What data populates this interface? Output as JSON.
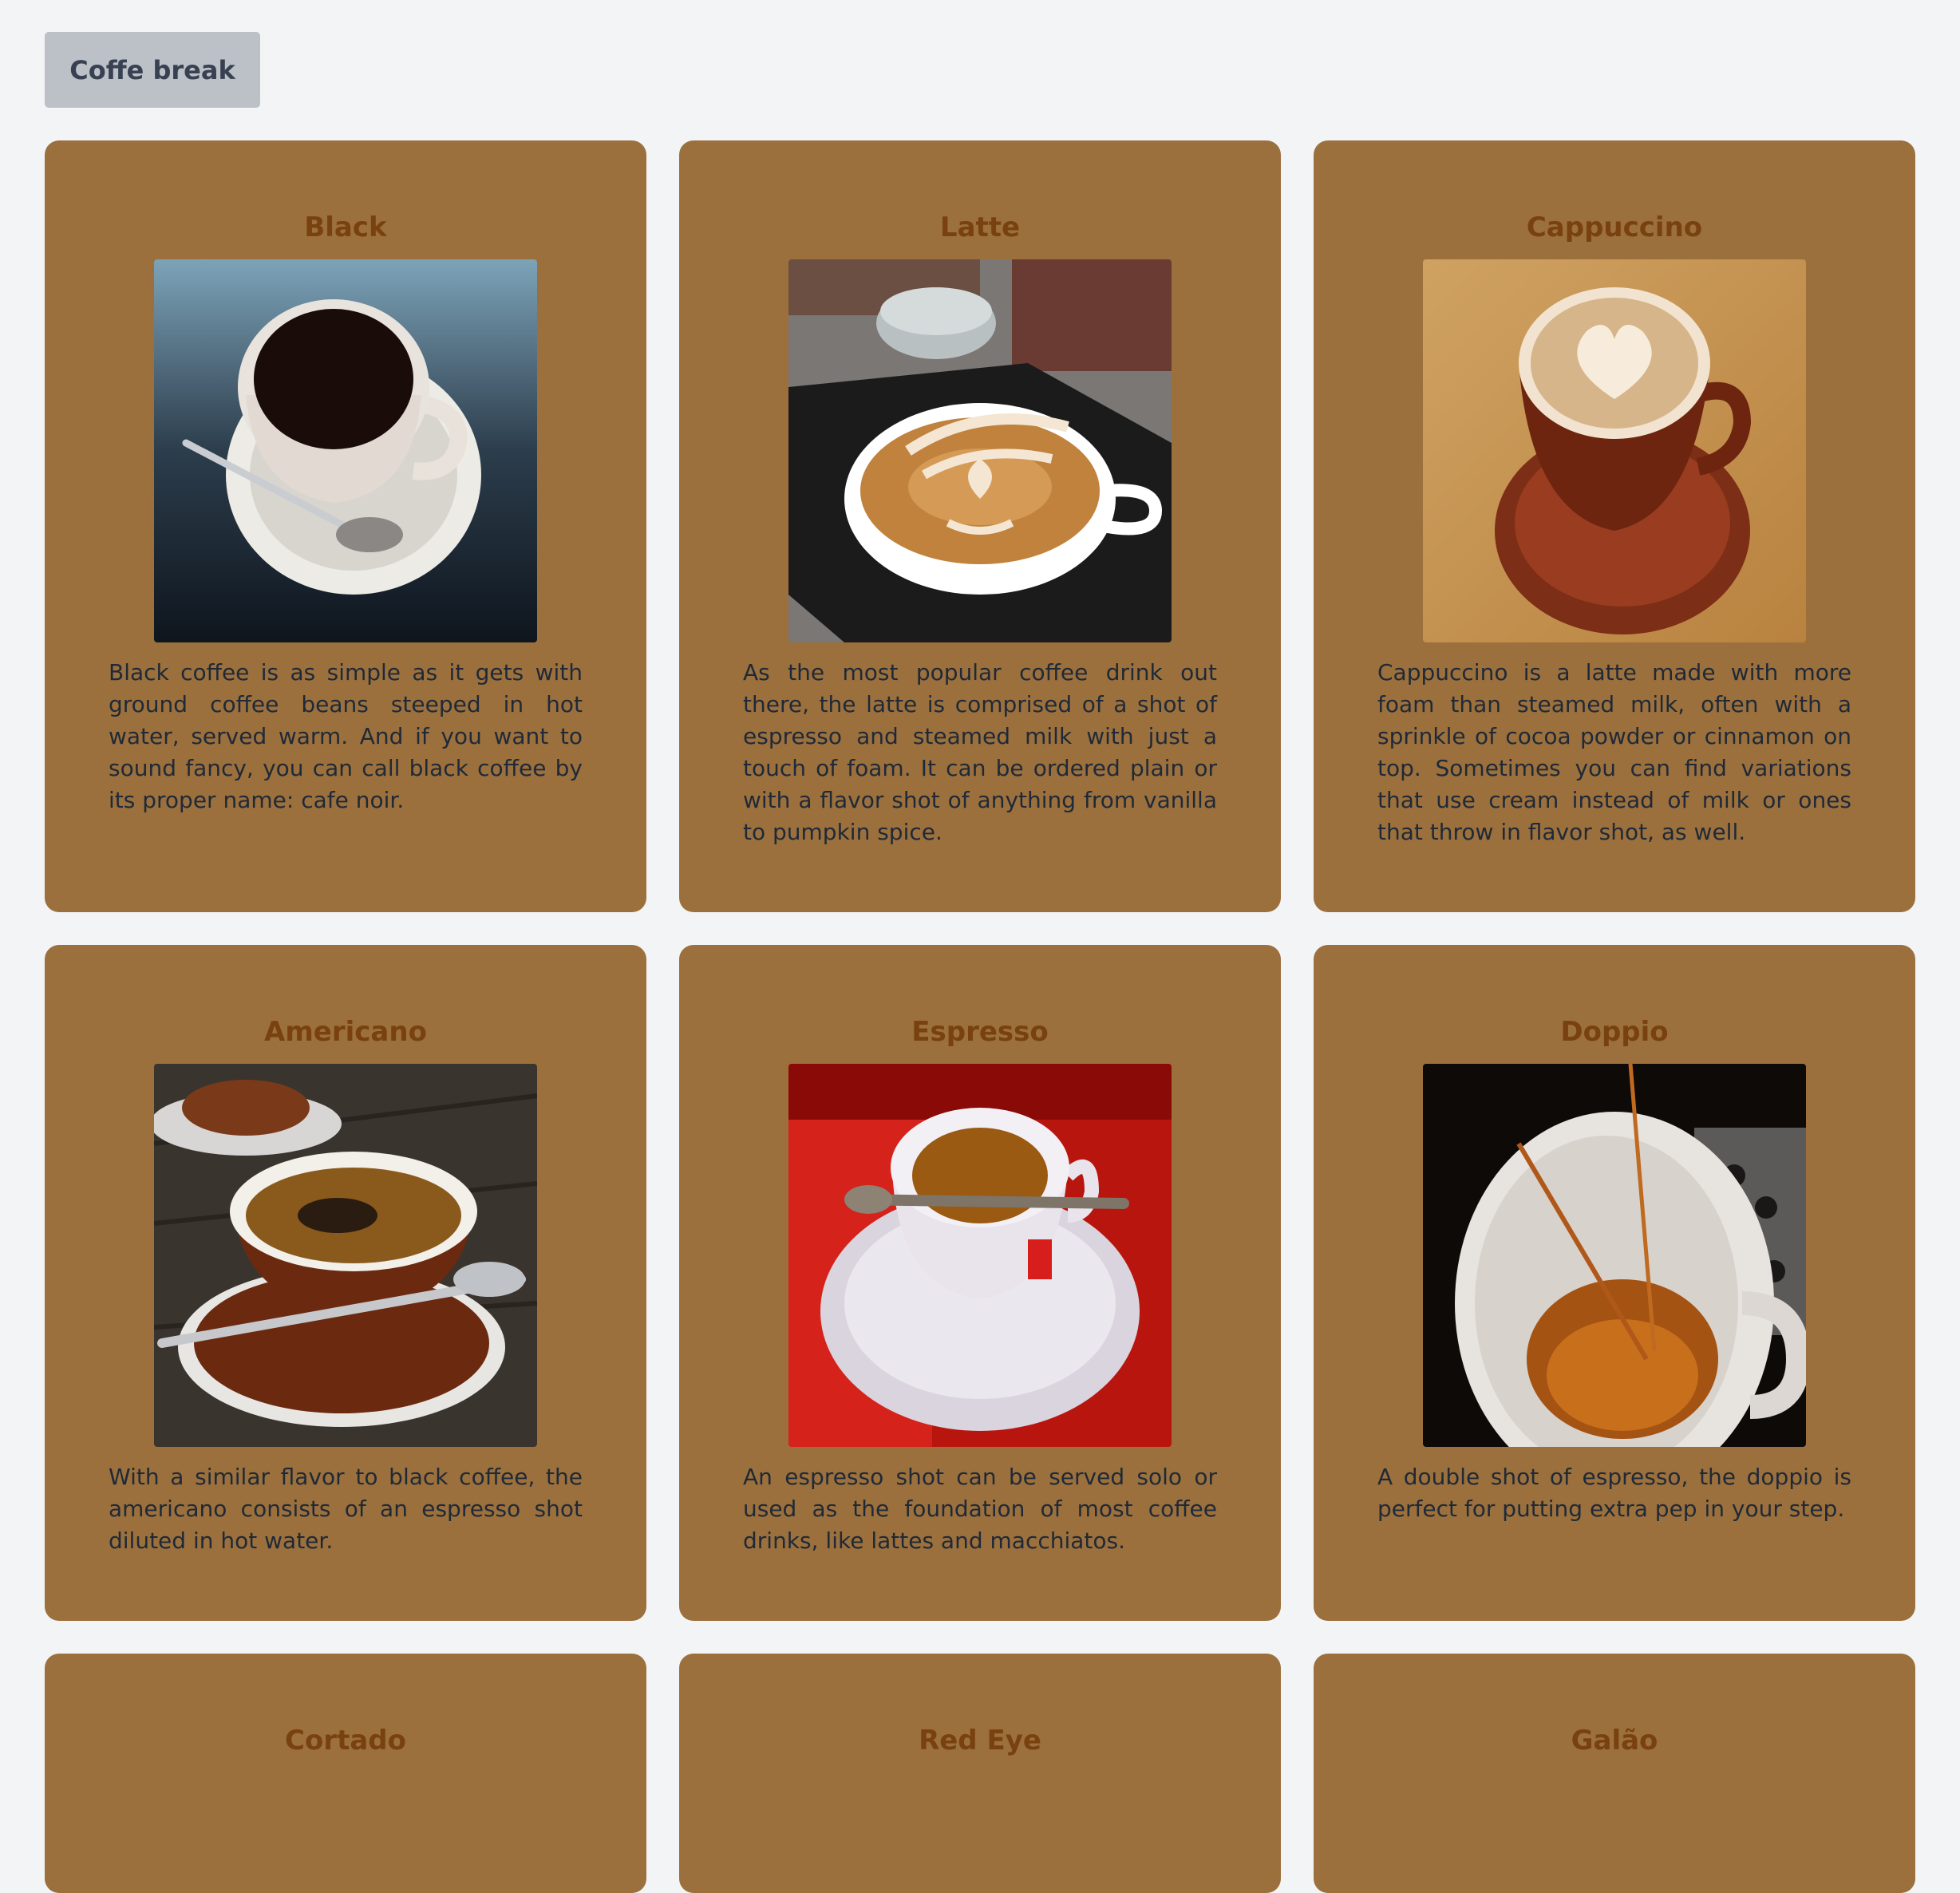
{
  "toolbar": {
    "button_label": "Coffe break"
  },
  "cards": [
    {
      "title": "Black",
      "image": "black-coffee-photo",
      "description": "Black coffee is as simple as it gets with ground coffee beans steeped in hot water, served warm. And if you want to sound fancy, you can call black coffee by its proper name: cafe noir."
    },
    {
      "title": "Latte",
      "image": "latte-photo",
      "description": "As the most popular coffee drink out there, the latte is comprised of a shot of espresso and steamed milk with just a touch of foam. It can be ordered plain or with a flavor shot of anything from vanilla to pumpkin spice."
    },
    {
      "title": "Cappuccino",
      "image": "cappuccino-photo",
      "description": "Cappuccino is a latte made with more foam than steamed milk, often with a sprinkle of cocoa powder or cinnamon on top. Sometimes you can find variations that use cream instead of milk or ones that throw in flavor shot, as well."
    },
    {
      "title": "Americano",
      "image": "americano-photo",
      "description": "With a similar flavor to black coffee, the americano consists of an espresso shot diluted in hot water."
    },
    {
      "title": "Espresso",
      "image": "espresso-photo",
      "description": "An espresso shot can be served solo or used as the foundation of most coffee drinks, like lattes and macchiatos."
    },
    {
      "title": "Doppio",
      "image": "doppio-photo",
      "description": "A double shot of espresso, the doppio is perfect for putting extra pep in your step."
    },
    {
      "title": "Cortado",
      "image": "cortado-photo",
      "description": ""
    },
    {
      "title": "Red Eye",
      "image": "red-eye-photo",
      "description": ""
    },
    {
      "title": "Galão",
      "image": "galao-photo",
      "description": ""
    }
  ],
  "colors": {
    "card_bg": "#9b703d",
    "title": "#78410f",
    "page_bg": "#f3f4f6",
    "button_bg": "#bcc0c7"
  }
}
